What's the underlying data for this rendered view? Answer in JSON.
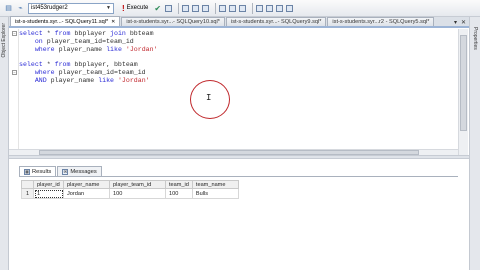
{
  "toolbar": {
    "database": "ist453rudger2",
    "execute_label": "Execute"
  },
  "side": {
    "left_label": "Object Explorer",
    "right_label": "Properties"
  },
  "tabs": [
    {
      "label": "ist-s-students.syr...- SQLQuery11.sql*",
      "active": true
    },
    {
      "label": "ist-s-students.syr...- SQLQuery10.sql*",
      "active": false
    },
    {
      "label": "ist-s-students.syr...- SQLQuery9.sql*",
      "active": false
    },
    {
      "label": "ist-s-students.syr...r2 - SQLQuery5.sql*",
      "active": false
    }
  ],
  "editor": {
    "lines": [
      [
        {
          "t": "kw",
          "v": "select"
        },
        {
          "t": "plain",
          "v": " * "
        },
        {
          "t": "kw",
          "v": "from"
        },
        {
          "t": "plain",
          "v": " bbplayer "
        },
        {
          "t": "kw",
          "v": "join"
        },
        {
          "t": "plain",
          "v": " bbteam"
        }
      ],
      [
        {
          "t": "plain",
          "v": "    "
        },
        {
          "t": "kw",
          "v": "on"
        },
        {
          "t": "plain",
          "v": " player_team_id=team_id"
        }
      ],
      [
        {
          "t": "plain",
          "v": "    "
        },
        {
          "t": "kw",
          "v": "where"
        },
        {
          "t": "plain",
          "v": " player_name "
        },
        {
          "t": "kw",
          "v": "like"
        },
        {
          "t": "plain",
          "v": " "
        },
        {
          "t": "str",
          "v": "'Jordan'"
        }
      ],
      [],
      [
        {
          "t": "kw",
          "v": "select"
        },
        {
          "t": "plain",
          "v": " * "
        },
        {
          "t": "kw",
          "v": "from"
        },
        {
          "t": "plain",
          "v": " bbplayer, bbteam"
        }
      ],
      [
        {
          "t": "plain",
          "v": "    "
        },
        {
          "t": "kw",
          "v": "where"
        },
        {
          "t": "plain",
          "v": " player_team_id=team_id"
        }
      ],
      [
        {
          "t": "plain",
          "v": "    "
        },
        {
          "t": "kw",
          "v": "AND"
        },
        {
          "t": "plain",
          "v": " player_name "
        },
        {
          "t": "kw",
          "v": "like"
        },
        {
          "t": "plain",
          "v": " "
        },
        {
          "t": "str",
          "v": "'Jordan'"
        }
      ]
    ]
  },
  "results": {
    "tabs": [
      {
        "label": "Results",
        "active": true
      },
      {
        "label": "Messages",
        "active": false
      }
    ],
    "columns": [
      "player_id",
      "player_name",
      "player_team_id",
      "team_id",
      "team_name"
    ],
    "rows": [
      {
        "num": "1",
        "cells": [
          "1",
          "Jordan",
          "100",
          "100",
          "Bulls"
        ]
      }
    ]
  },
  "icons": [
    "database-icon",
    "execute-icon",
    "check-icon",
    "close-icon",
    "pin-icon"
  ],
  "colors": {
    "keyword": "#2b2bd6",
    "string": "#c1272d",
    "annotation_circle": "#c0282c"
  }
}
